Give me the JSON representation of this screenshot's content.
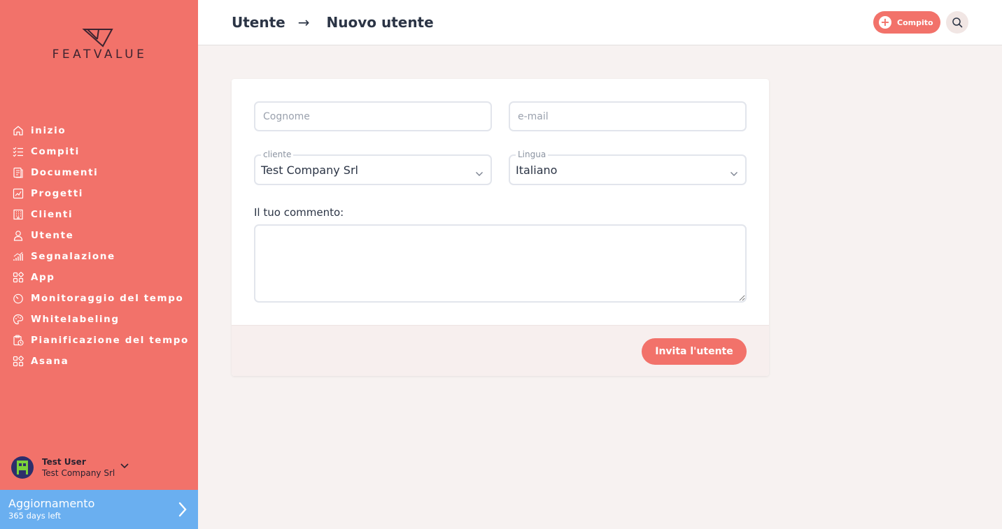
{
  "brand": {
    "logo_text": "FEATVALUE",
    "accent": "#f2726a",
    "upgrade_color": "#6aaff0"
  },
  "sidebar": {
    "items": [
      {
        "label": "inizio",
        "icon": "home-icon"
      },
      {
        "label": "Compiti",
        "icon": "checklist-icon"
      },
      {
        "label": "Documenti",
        "icon": "document-icon"
      },
      {
        "label": "Progetti",
        "icon": "chart-icon"
      },
      {
        "label": "Clienti",
        "icon": "building-icon"
      },
      {
        "label": "Utente",
        "icon": "user-icon"
      },
      {
        "label": "Segnalazione",
        "icon": "signal-icon"
      },
      {
        "label": "App",
        "icon": "apps-icon"
      },
      {
        "label": "Monitoraggio del tempo",
        "icon": "timer-icon"
      },
      {
        "label": "Whitelabeling",
        "icon": "palette-icon"
      },
      {
        "label": "Pianificazione del tempo",
        "icon": "clipboard-clock-icon"
      },
      {
        "label": "Asana",
        "icon": "apps-icon"
      }
    ],
    "user": {
      "name": "Test User",
      "company": "Test Company Srl"
    },
    "upgrade": {
      "title": "Aggiornamento",
      "subtitle": "365 days left"
    }
  },
  "header": {
    "crumb_parent": "Utente",
    "crumb_arrow": "→",
    "crumb_current": "Nuovo utente",
    "task_button": "Compito"
  },
  "form": {
    "surname_placeholder": "Cognome",
    "email_placeholder": "e-mail",
    "client_label": "cliente",
    "client_value": "Test Company Srl",
    "language_label": "Lingua",
    "language_value": "Italiano",
    "comment_label": "Il tuo commento:",
    "invite_button": "Invita l'utente"
  }
}
